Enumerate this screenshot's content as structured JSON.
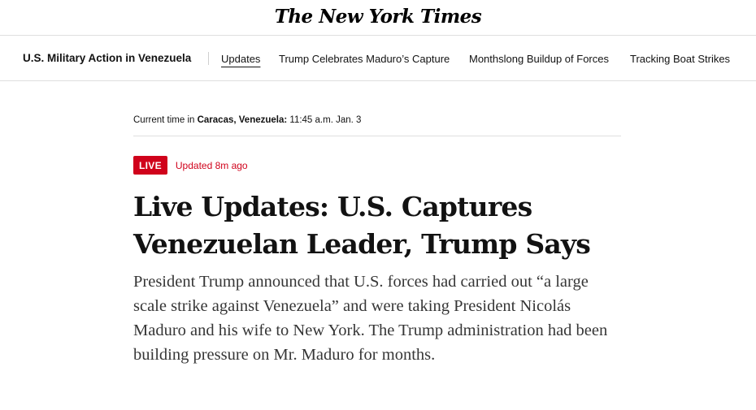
{
  "masthead": {
    "logo": "The New York Times"
  },
  "subnav": {
    "title": "U.S. Military Action in Venezuela",
    "links": [
      {
        "label": "Updates",
        "active": true
      },
      {
        "label": "Trump Celebrates Maduro’s Capture",
        "active": false
      },
      {
        "label": "Monthslong Buildup of Forces",
        "active": false
      },
      {
        "label": "Tracking Boat Strikes",
        "active": false
      }
    ]
  },
  "timebar": {
    "prefix": "Current time in ",
    "location": "Caracas, Venezuela:",
    "time": " 11:45 a.m. Jan. 3"
  },
  "live": {
    "badge": "LIVE",
    "updated": "Updated 8m ago"
  },
  "article": {
    "headline": "Live Updates: U.S. Captures Venezuelan Leader, Trump Says",
    "summary": "President Trump announced that U.S. forces had carried out “a large scale strike against Venezuela” and were taking President Nicolás Maduro and his wife to New York. The Trump administration had been building pressure on Mr. Maduro for months."
  },
  "colors": {
    "live_red": "#d0021b",
    "divider": "#dfdfdf",
    "text": "#121212"
  }
}
